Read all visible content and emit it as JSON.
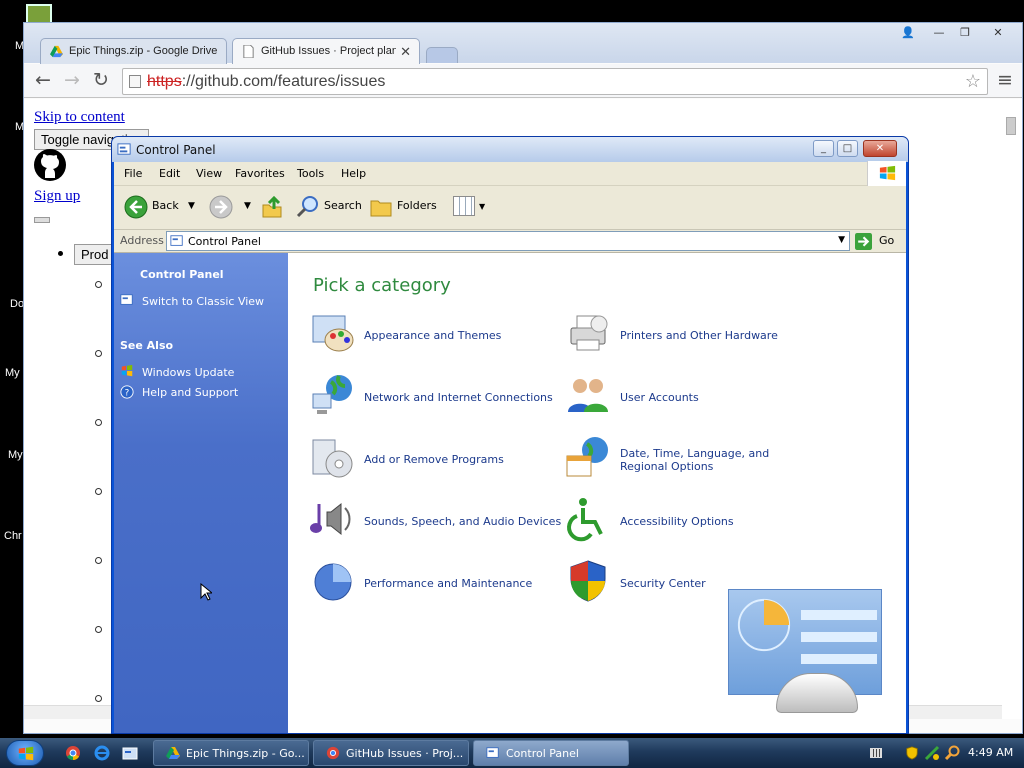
{
  "desktop": {
    "labels": [
      "M",
      "M",
      "Do",
      "My",
      "My",
      "Chr"
    ]
  },
  "chrome": {
    "tabs": [
      {
        "label": "Epic Things.zip - Google Drive"
      },
      {
        "label": "GitHub Issues · Project planning"
      }
    ],
    "url_scheme": "https",
    "url_rest": "://github.com/features/issues",
    "page": {
      "skip_link": "Skip to content",
      "toggle_nav": "Toggle navigation",
      "sign_up": "Sign up",
      "product_btn": "Prod"
    }
  },
  "control_panel": {
    "title": "Control Panel",
    "menu": [
      "File",
      "Edit",
      "View",
      "Favorites",
      "Tools",
      "Help"
    ],
    "toolbar": {
      "back": "Back",
      "search": "Search",
      "folders": "Folders"
    },
    "address_label": "Address",
    "address_value": "Control Panel",
    "go_label": "Go",
    "sidebar": {
      "section_title": "Control Panel",
      "switch_view": "Switch to Classic View",
      "see_also_title": "See Also",
      "links": [
        "Windows Update",
        "Help and Support"
      ]
    },
    "heading": "Pick a category",
    "categories": [
      {
        "label": "Appearance and Themes",
        "icon": "appearance-icon"
      },
      {
        "label": "Printers and Other Hardware",
        "icon": "printer-icon"
      },
      {
        "label": "Network and Internet Connections",
        "icon": "network-icon"
      },
      {
        "label": "User Accounts",
        "icon": "user-accounts-icon"
      },
      {
        "label": "Add or Remove Programs",
        "icon": "add-remove-programs-icon"
      },
      {
        "label": "Date, Time, Language, and Regional Options",
        "icon": "date-time-icon"
      },
      {
        "label": "Sounds, Speech, and Audio Devices",
        "icon": "sounds-icon"
      },
      {
        "label": "Accessibility Options",
        "icon": "accessibility-icon"
      },
      {
        "label": "Performance and Maintenance",
        "icon": "performance-icon"
      },
      {
        "label": "Security Center",
        "icon": "security-shield-icon"
      }
    ]
  },
  "taskbar": {
    "items": [
      {
        "label": "Epic Things.zip - Go..."
      },
      {
        "label": "GitHub Issues · Proj..."
      },
      {
        "label": "Control Panel"
      }
    ],
    "clock": "4:49 AM"
  },
  "colors": {
    "xp_blue": "#0a53d6",
    "category_text": "#1c3a8c",
    "heading_green": "#2f8a3f",
    "link_blue": "#0000cc"
  }
}
